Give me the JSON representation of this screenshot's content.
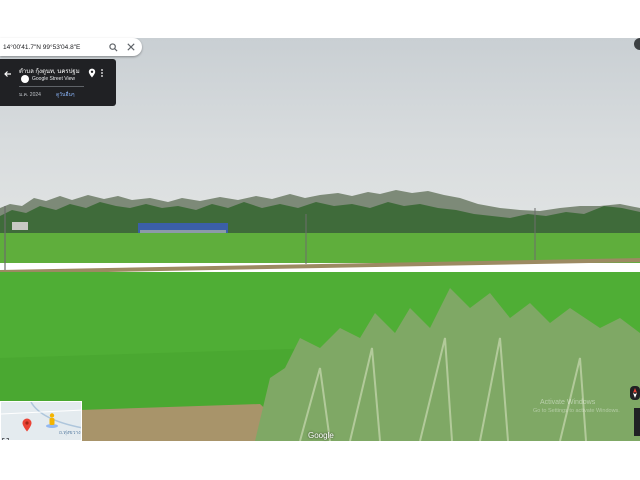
{
  "search": {
    "coordinates": "14°00'41.7\"N 99°53'04.8\"E"
  },
  "info_card": {
    "place_name": "ตำบล กุ้งตูนท, นครปฐม",
    "source": "Google Street View",
    "date": "ม.ค. 2024",
    "more_dates": "ดูวันอื่นๆ"
  },
  "minimap": {
    "label": "ถ.ทุ่งขวาง"
  },
  "footer": {
    "logo_text": "Google"
  },
  "watermark": {
    "title": "Activate Windows",
    "subtitle": "Go to Settings to activate Windows."
  },
  "icons": {
    "search": "search-icon",
    "close": "close-icon",
    "back": "arrow-left-icon",
    "pin": "location-pin-icon",
    "more": "more-vert-icon",
    "pegman": "pegman-icon",
    "compass": "compass-icon"
  },
  "colors": {
    "card_bg": "#202124",
    "link": "#8ab4f8",
    "field_green": "#4fae35",
    "map_pin": "#ea4335"
  }
}
